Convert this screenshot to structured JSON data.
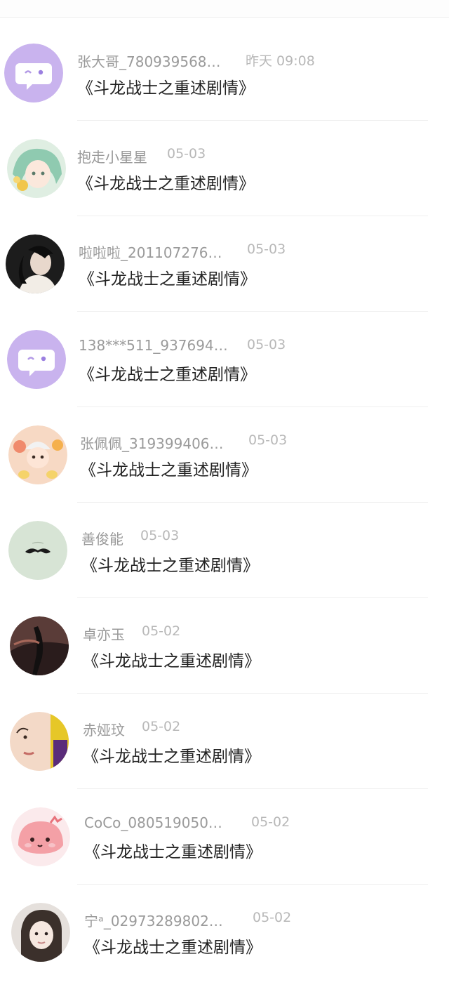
{
  "messages": [
    {
      "name": "张大哥_780939568…",
      "time": "昨天 09:08",
      "title": "《斗龙战士之重述剧情》",
      "avatar": "default-chat-avatar"
    },
    {
      "name": "抱走小星星",
      "time": "05-03",
      "title": "《斗龙战士之重述剧情》",
      "avatar": "anime-girl-avatar"
    },
    {
      "name": "啦啦啦_201107276…",
      "time": "05-03",
      "title": "《斗龙战士之重述剧情》",
      "avatar": "portrait-avatar"
    },
    {
      "name": "138***511_937694…",
      "time": "05-03",
      "title": "《斗龙战士之重述剧情》",
      "avatar": "default-chat-avatar"
    },
    {
      "name": "张佩佩_319399406…",
      "time": "05-03",
      "title": "《斗龙战士之重述剧情》",
      "avatar": "cartoon-child-avatar"
    },
    {
      "name": "善俊能",
      "time": "05-03",
      "title": "《斗龙战士之重述剧情》",
      "avatar": "mustache-avatar"
    },
    {
      "name": "卓亦玉",
      "time": "05-02",
      "title": "《斗龙战士之重述剧情》",
      "avatar": "dark-figure-avatar"
    },
    {
      "name": "赤娅玟",
      "time": "05-02",
      "title": "《斗龙战士之重述剧情》",
      "avatar": "face-closeup-avatar"
    },
    {
      "name": "CoCo_080519050…",
      "time": "05-02",
      "title": "《斗龙战士之重述剧情》",
      "avatar": "pink-blob-avatar"
    },
    {
      "name": "宁ᵃ_02973289802…",
      "time": "05-02",
      "title": "《斗龙战士之重述剧情》",
      "avatar": "girl-photo-avatar"
    }
  ]
}
